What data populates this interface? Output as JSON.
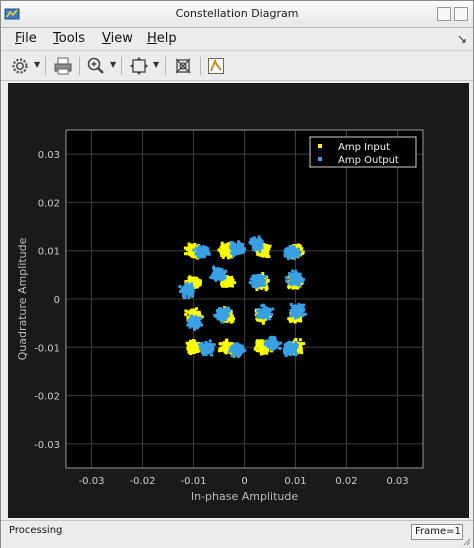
{
  "window": {
    "title": "Constellation Diagram"
  },
  "menu": {
    "items": [
      {
        "label": "File",
        "key": "F",
        "rest": "ile"
      },
      {
        "label": "Tools",
        "key": "T",
        "rest": "ools"
      },
      {
        "label": "View",
        "key": "V",
        "rest": "iew"
      },
      {
        "label": "Help",
        "key": "H",
        "rest": "elp"
      }
    ]
  },
  "toolbar": {
    "icons": [
      "settings-icon",
      "print-icon",
      "zoom-in-icon",
      "autoscale-icon",
      "measurements-icon",
      "highlight-icon"
    ]
  },
  "status": {
    "text": "Processing",
    "frame": "Frame=1"
  },
  "colors": {
    "input": "#ffff00",
    "output": "#3aa0e6",
    "plot_bg": "#000000",
    "panel_bg": "#1a1a1a"
  },
  "chart_data": {
    "type": "scatter",
    "xlabel": "In-phase Amplitude",
    "ylabel": "Quadrature Amplitude",
    "xlim": [
      -0.035,
      0.035
    ],
    "ylim": [
      -0.035,
      0.035
    ],
    "xticks": [
      "-0.03",
      "-0.02",
      "-0.01",
      "0",
      "0.01",
      "0.02",
      "0.03"
    ],
    "yticks": [
      "0.03",
      "0.02",
      "0.01",
      "0",
      "-0.01",
      "-0.02",
      "-0.03"
    ],
    "grid": true,
    "legend_position": "top-right",
    "constellation": "16-QAM",
    "series": [
      {
        "name": "Amp Input",
        "color": "#ffff00",
        "centers": [
          [
            -0.01,
            0.01
          ],
          [
            -0.0035,
            0.01
          ],
          [
            0.0035,
            0.01
          ],
          [
            0.01,
            0.01
          ],
          [
            -0.01,
            0.0035
          ],
          [
            -0.0035,
            0.0035
          ],
          [
            0.0035,
            0.0035
          ],
          [
            0.01,
            0.0035
          ],
          [
            -0.01,
            -0.0035
          ],
          [
            -0.0035,
            -0.0035
          ],
          [
            0.0035,
            -0.0035
          ],
          [
            0.01,
            -0.0035
          ],
          [
            -0.01,
            -0.01
          ],
          [
            -0.0035,
            -0.01
          ],
          [
            0.0035,
            -0.01
          ],
          [
            0.01,
            -0.01
          ]
        ],
        "spread": 0.0011
      },
      {
        "name": "Amp Output",
        "color": "#3aa0e6",
        "centers": [
          [
            -0.0083,
            0.0098
          ],
          [
            -0.0015,
            0.0105
          ],
          [
            0.0025,
            0.0115
          ],
          [
            0.0093,
            0.0098
          ],
          [
            -0.0111,
            0.0016
          ],
          [
            -0.0051,
            0.0052
          ],
          [
            0.0027,
            0.0037
          ],
          [
            0.0099,
            0.0043
          ],
          [
            -0.0097,
            -0.0048
          ],
          [
            -0.0044,
            -0.0032
          ],
          [
            0.0039,
            -0.0028
          ],
          [
            0.0105,
            -0.0025
          ],
          [
            -0.0073,
            -0.0102
          ],
          [
            -0.0014,
            -0.0105
          ],
          [
            0.0056,
            -0.0092
          ],
          [
            0.0091,
            -0.0102
          ]
        ],
        "spread": 0.0011
      }
    ]
  }
}
